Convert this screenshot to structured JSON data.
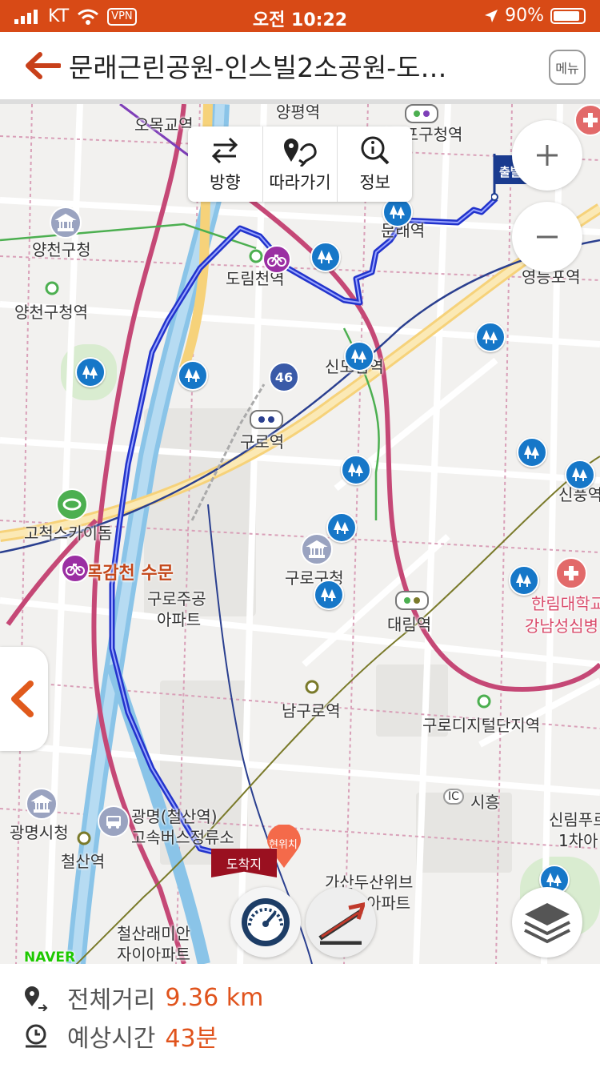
{
  "status_bar": {
    "carrier": "KT",
    "vpn": "VPN",
    "time": "오전 10:22",
    "battery": "90%",
    "battery_level": 0.9
  },
  "header": {
    "title": "문래근린공원-인스빌2소공원-도…",
    "menu_label": "메뉴"
  },
  "toolbar": {
    "direction_label": "방향",
    "follow_label": "따라가기",
    "info_label": "정보"
  },
  "map": {
    "labels": {
      "omokgyo": "오목교역",
      "yangpyeong": "양평역",
      "yeongdeungpo_gucheong": "영등포구청역",
      "yangcheon_gucheong": "양천구청",
      "yangcheon_gucheong_station": "양천구청역",
      "dorimcheon": "도림천역",
      "mullae": "문래역",
      "yeongdeungpo_station": "영등포역",
      "sindorim": "신도림역",
      "guro_station": "구로역",
      "gocheok_skydome": "고척스카이돔",
      "mokgamcheon_sumun": "목감천 수문",
      "guro_jugong": "구로주공",
      "apartment": "아파트",
      "guro_gucheong": "구로구청",
      "daerim": "대림역",
      "sinpung": "신풍역",
      "hallym_hospital_1": "한림대학교",
      "hallym_hospital_2": "강남성심병",
      "namguro": "남구로역",
      "guro_digital": "구로디지털단지역",
      "siheung_ic": "시흥",
      "ic_badge": "IC",
      "gwangmyeong_hall": "광명시청",
      "gwangmyeong_bus_1": "광명(철산역)",
      "gwangmyeong_bus_2": "고속버스정류소",
      "cheolsan": "철산역",
      "gasan_1": "가산두산위브",
      "gasan_2": "아파트",
      "cheolsan_raemian_1": "철산래미안",
      "cheolsan_raemian_2": "자이아파트",
      "sillim_1": "신림푸르",
      "sillim_2": "1차아",
      "start_flag": "출발",
      "end_flag": "도착지",
      "current_pos": "현위치",
      "route_46": "46"
    }
  },
  "brand": "NAVER",
  "summary": {
    "distance_label": "전체거리",
    "distance_value": "9.36 km",
    "time_label": "예상시간",
    "time_value": "43분"
  },
  "colors": {
    "status_bar": "#d84a16",
    "accent": "#e0531c",
    "route": "#2233cc",
    "park_icon": "#1677c8"
  }
}
